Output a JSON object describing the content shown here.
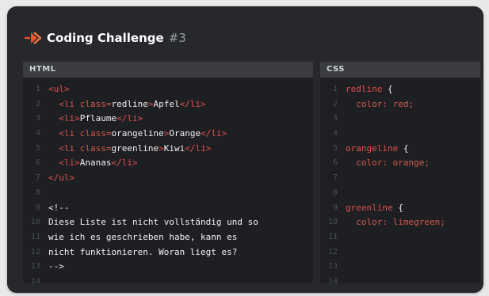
{
  "header": {
    "title": "Coding Challenge",
    "number": "#3"
  },
  "colors": {
    "accent": "#e8552d",
    "background": "#26282c",
    "panel": "#1e1f22"
  },
  "panels": {
    "html": {
      "label": "HTML",
      "line_numbers": [
        "1",
        "2",
        "3",
        "4",
        "5",
        "6",
        "7",
        "8",
        "9",
        "10",
        "11",
        "12",
        "13",
        "14"
      ],
      "lines": [
        "<ul>",
        "  <li class=\"redline\">Apfel</li>",
        "  <li>Pflaume</li>",
        "  <li class=\"orangeline\">Orange</li>",
        "  <li class=\"greenline\">Kiwi</li>",
        "  <li>Ananas</li>",
        "</ul>",
        "",
        "<!--",
        "Diese Liste ist nicht vollständig und so",
        "wie ich es geschrieben habe, kann es",
        "nicht funktionieren. Woran liegt es?",
        "-->",
        ""
      ]
    },
    "css": {
      "label": "CSS",
      "line_numbers": [
        "1",
        "2",
        "3",
        "4",
        "5",
        "6",
        "7",
        "8",
        "9",
        "10",
        "11",
        "12",
        "13",
        "14"
      ],
      "lines": [
        "redline {",
        "  color: red;",
        "",
        "",
        "orangeline {",
        "  color: orange;",
        "",
        "",
        "greenline {",
        "  color: limegreen;",
        "",
        "",
        "",
        ""
      ]
    }
  }
}
